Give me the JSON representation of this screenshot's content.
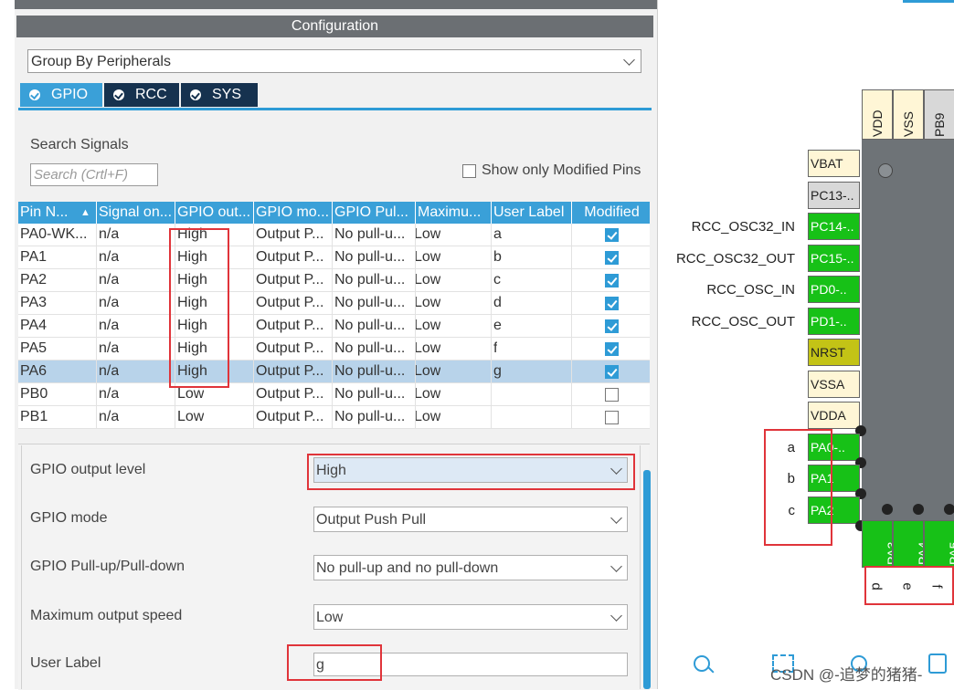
{
  "configuration": {
    "title": "Configuration",
    "group_by": "Group By Peripherals",
    "tabs": [
      {
        "label": "GPIO"
      },
      {
        "label": "RCC"
      },
      {
        "label": "SYS"
      }
    ],
    "search": {
      "label": "Search Signals",
      "placeholder": "Search (Crtl+F)"
    },
    "show_modified_label": "Show only Modified Pins"
  },
  "table": {
    "headers": [
      "Pin N...",
      "Signal on...",
      "GPIO out...",
      "GPIO mo...",
      "GPIO Pul...",
      "Maximu...",
      "User Label",
      "Modified"
    ],
    "rows": [
      {
        "pin": "PA0-WK...",
        "signal": "n/a",
        "out": "High",
        "mode": "Output P...",
        "pull": "No pull-u...",
        "speed": "Low",
        "label": "a",
        "modified": true
      },
      {
        "pin": "PA1",
        "signal": "n/a",
        "out": "High",
        "mode": "Output P...",
        "pull": "No pull-u...",
        "speed": "Low",
        "label": "b",
        "modified": true
      },
      {
        "pin": "PA2",
        "signal": "n/a",
        "out": "High",
        "mode": "Output P...",
        "pull": "No pull-u...",
        "speed": "Low",
        "label": "c",
        "modified": true
      },
      {
        "pin": "PA3",
        "signal": "n/a",
        "out": "High",
        "mode": "Output P...",
        "pull": "No pull-u...",
        "speed": "Low",
        "label": "d",
        "modified": true
      },
      {
        "pin": "PA4",
        "signal": "n/a",
        "out": "High",
        "mode": "Output P...",
        "pull": "No pull-u...",
        "speed": "Low",
        "label": "e",
        "modified": true
      },
      {
        "pin": "PA5",
        "signal": "n/a",
        "out": "High",
        "mode": "Output P...",
        "pull": "No pull-u...",
        "speed": "Low",
        "label": "f",
        "modified": true
      },
      {
        "pin": "PA6",
        "signal": "n/a",
        "out": "High",
        "mode": "Output P...",
        "pull": "No pull-u...",
        "speed": "Low",
        "label": "g",
        "modified": true
      },
      {
        "pin": "PB0",
        "signal": "n/a",
        "out": "Low",
        "mode": "Output P...",
        "pull": "No pull-u...",
        "speed": "Low",
        "label": "",
        "modified": false
      },
      {
        "pin": "PB1",
        "signal": "n/a",
        "out": "Low",
        "mode": "Output P...",
        "pull": "No pull-u...",
        "speed": "Low",
        "label": "",
        "modified": false
      }
    ],
    "selected_row": "PA6"
  },
  "properties": {
    "output_level": {
      "label": "GPIO output level",
      "value": "High"
    },
    "mode": {
      "label": "GPIO mode",
      "value": "Output Push Pull"
    },
    "pull": {
      "label": "GPIO Pull-up/Pull-down",
      "value": "No pull-up and no pull-down"
    },
    "speed": {
      "label": "Maximum output speed",
      "value": "Low"
    },
    "user_label": {
      "label": "User Label",
      "value": "g"
    }
  },
  "chip": {
    "top_pins": [
      "VDD",
      "VSS",
      "PB9"
    ],
    "left_pins": [
      {
        "name": "VBAT",
        "signal": ""
      },
      {
        "name": "PC13-..",
        "signal": ""
      },
      {
        "name": "PC14-..",
        "signal": "RCC_OSC32_IN"
      },
      {
        "name": "PC15-..",
        "signal": "RCC_OSC32_OUT"
      },
      {
        "name": "PD0-..",
        "signal": "RCC_OSC_IN"
      },
      {
        "name": "PD1-..",
        "signal": "RCC_OSC_OUT"
      },
      {
        "name": "NRST",
        "signal": ""
      },
      {
        "name": "VSSA",
        "signal": ""
      },
      {
        "name": "VDDA",
        "signal": ""
      },
      {
        "name": "PA0-..",
        "signal": "a"
      },
      {
        "name": "PA1",
        "signal": "b"
      },
      {
        "name": "PA2",
        "signal": "c"
      }
    ],
    "bottom_pins": [
      {
        "name": "PA3",
        "signal": "d"
      },
      {
        "name": "PA4",
        "signal": "e"
      },
      {
        "name": "PA5",
        "signal": "f"
      }
    ]
  },
  "watermark": "CSDN @-追梦的猪猪-",
  "colors": {
    "accent": "#3aa0d8",
    "tab_dark": "#16324f",
    "pin_green": "#17c117",
    "highlight": "#e0343a"
  }
}
